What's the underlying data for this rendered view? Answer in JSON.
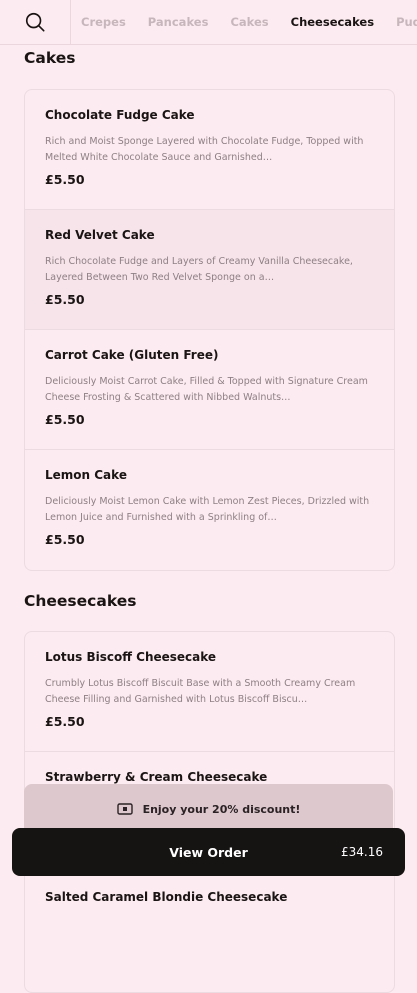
{
  "nav": {
    "tabs": [
      {
        "label": "Crepes"
      },
      {
        "label": "Pancakes"
      },
      {
        "label": "Cakes"
      },
      {
        "label": "Cheesecakes"
      },
      {
        "label": "Pudd"
      }
    ],
    "active_tab": "Cheesecakes"
  },
  "sections": [
    {
      "title": "Cakes",
      "items": [
        {
          "name": "Chocolate Fudge Cake",
          "description": "Rich and Moist Sponge Layered with Chocolate Fudge, Topped with Melted White Chocolate Sauce and Garnished…",
          "price": "£5.50"
        },
        {
          "name": "Red Velvet Cake",
          "description": "Rich Chocolate Fudge and Layers of Creamy Vanilla Cheesecake, Layered Between Two Red Velvet Sponge on a…",
          "price": "£5.50"
        },
        {
          "name": "Carrot Cake (Gluten Free)",
          "description": "Deliciously Moist Carrot Cake, Filled & Topped with Signature Cream Cheese Frosting & Scattered with Nibbed Walnuts…",
          "price": "£5.50"
        },
        {
          "name": "Lemon Cake",
          "description": "Deliciously Moist Lemon Cake with Lemon Zest Pieces, Drizzled with Lemon Juice and Furnished with a Sprinkling of…",
          "price": "£5.50"
        }
      ]
    },
    {
      "title": "Cheesecakes",
      "items": [
        {
          "name": "Lotus Biscoff Cheesecake",
          "description": "Crumbly Lotus Biscoff Biscuit Base with a Smooth Creamy Cream Cheese Filling and Garnished with Lotus Biscoff Biscu…",
          "price": "£5.50"
        },
        {
          "name": "Strawberry & Cream Cheesecake",
          "description": "",
          "price": ""
        },
        {
          "name": "Salted Caramel Blondie Cheesecake",
          "description": "",
          "price": ""
        }
      ]
    }
  ],
  "discount_banner": {
    "text": "Enjoy your 20% discount!"
  },
  "order_bar": {
    "label": "View Order",
    "total": "£34.16"
  },
  "colors": {
    "background": "#fcebf0",
    "order_bar": "#161313",
    "discount_bar": "#ddc8ce"
  },
  "icons": {
    "search": "search-icon",
    "discount": "ticket-icon"
  }
}
